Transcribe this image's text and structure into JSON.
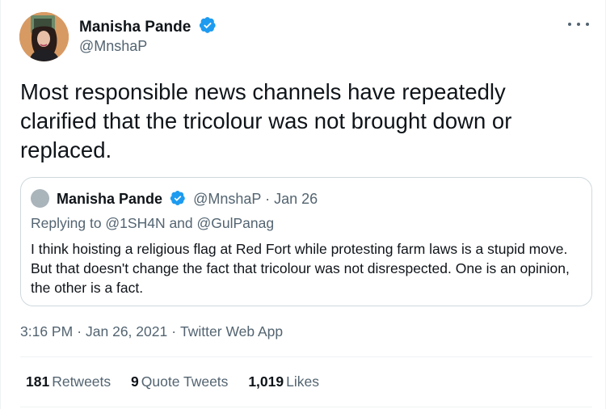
{
  "tweet": {
    "author": {
      "name": "Manisha Pande",
      "handle": "@MnshaP",
      "verified": true
    },
    "more_icon": "more-dots-icon",
    "text": "Most responsible news channels have repeatedly clarified that the tricolour was not brought down or replaced.",
    "timestamp": "3:16 PM",
    "date": "Jan 26, 2021",
    "source": "Twitter Web App",
    "separator": "·"
  },
  "quoted": {
    "author_name": "Manisha Pande",
    "handle": "@MnshaP",
    "date": "Jan 26",
    "separator": "·",
    "replying_to": "Replying to @1SH4N and @GulPanag",
    "text": "I think hoisting a religious flag at Red Fort while protesting farm laws is a stupid move. But that doesn't change the fact that tricolour was not disrespected. One is an opinion, the other is a fact."
  },
  "stats": {
    "retweets": {
      "count": "181",
      "label": "Retweets"
    },
    "quote_tweets": {
      "count": "9",
      "label": "Quote Tweets"
    },
    "likes": {
      "count": "1,019",
      "label": "Likes"
    }
  },
  "colors": {
    "verified_badge": "#1d9bf0",
    "secondary_text": "#536471",
    "border": "#cfd9de"
  }
}
